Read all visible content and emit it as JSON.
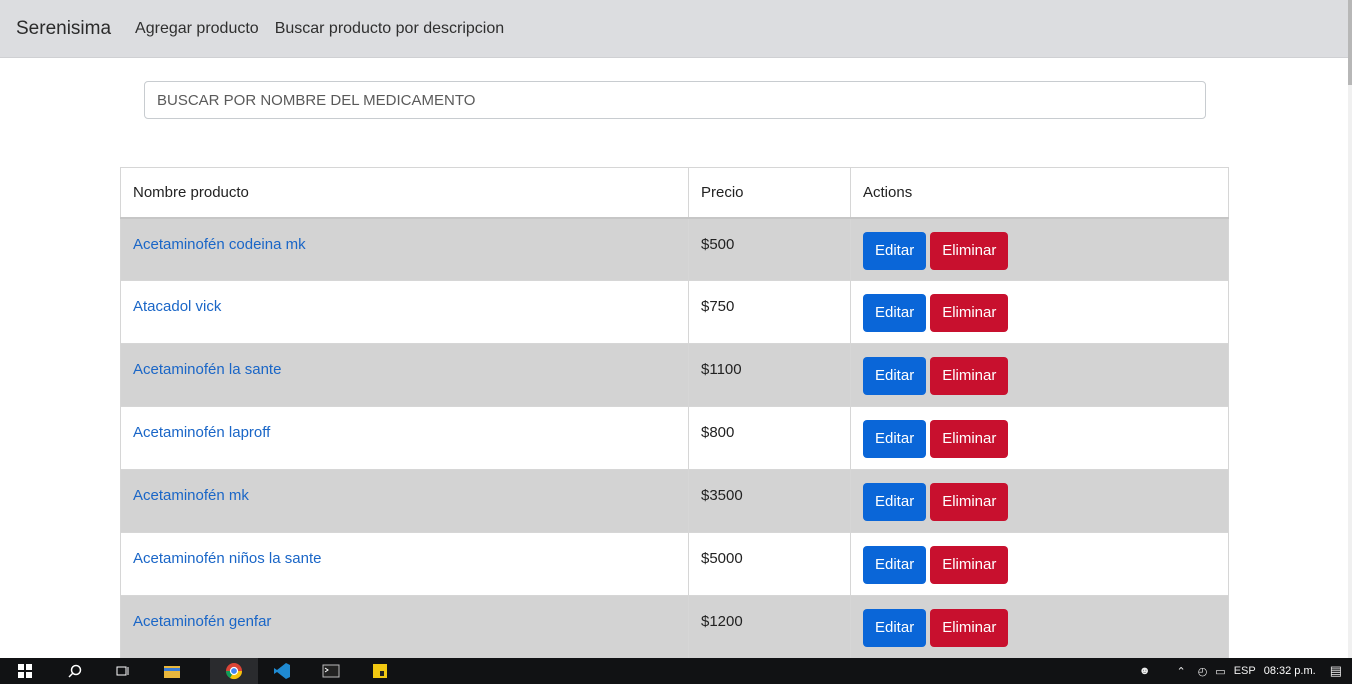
{
  "navbar": {
    "brand": "Serenisima",
    "links": [
      "Agregar producto",
      "Buscar producto por descripcion"
    ]
  },
  "search": {
    "placeholder": "BUSCAR POR NOMBRE DEL MEDICAMENTO"
  },
  "table": {
    "headers": [
      "Nombre producto",
      "Precio",
      "Actions"
    ],
    "edit_label": "Editar",
    "delete_label": "Eliminar",
    "rows": [
      {
        "name": "Acetaminofén codeina mk",
        "price": "$500"
      },
      {
        "name": "Atacadol vick",
        "price": "$750"
      },
      {
        "name": "Acetaminofén la sante",
        "price": "$1100"
      },
      {
        "name": "Acetaminofén laproff",
        "price": "$800"
      },
      {
        "name": "Acetaminofén mk",
        "price": "$3500"
      },
      {
        "name": "Acetaminofén niños la sante",
        "price": "$5000"
      },
      {
        "name": "Acetaminofén genfar",
        "price": "$1200"
      }
    ]
  },
  "taskbar": {
    "language": "ESP",
    "time": "08:32 p.m.",
    "icons": [
      "windows-icon",
      "search-icon",
      "task-view-icon",
      "file-explorer-icon",
      "chrome-icon",
      "vscode-icon",
      "terminal-icon",
      "app-icon"
    ]
  },
  "colors": {
    "navbar_bg": "#dcdde0",
    "link": "#1a66c7",
    "edit_button": "#0a66d8",
    "delete_button": "#c8102e",
    "striped_row": "#d3d3d3"
  }
}
